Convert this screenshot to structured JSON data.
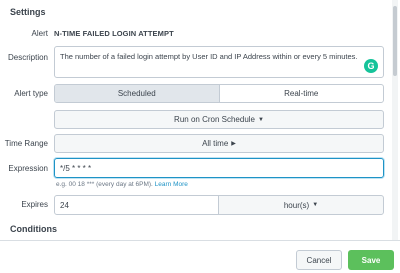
{
  "settings": {
    "section_title": "Settings",
    "alert_label": "Alert",
    "alert_name": "N-TIME FAILED LOGIN ATTEMPT",
    "description_label": "Description",
    "description_value": "The number of a failed login attempt by User ID and IP Address within or every 5 minutes.",
    "grammar_badge": "G",
    "alert_type_label": "Alert type",
    "alert_type_options": [
      "Scheduled",
      "Real-time"
    ],
    "alert_type_selected": "Scheduled",
    "schedule_button": "Run on Cron Schedule",
    "time_range_label": "Time Range",
    "time_range_button": "All time",
    "expression_label": "Expression",
    "expression_value": "*/5 * * * *",
    "expression_hint": "e.g. 00 18 *** (every day at 6PM).",
    "learn_more": "Learn More",
    "expires_label": "Expires",
    "expires_value": "24",
    "expires_unit": "hour(s)",
    "conditions_title": "Conditions"
  },
  "footer": {
    "cancel_label": "Cancel",
    "save_label": "Save"
  },
  "colors": {
    "accent": "#1e93c6",
    "save_button": "#5cc05c",
    "grammar_badge": "#15c39a"
  }
}
